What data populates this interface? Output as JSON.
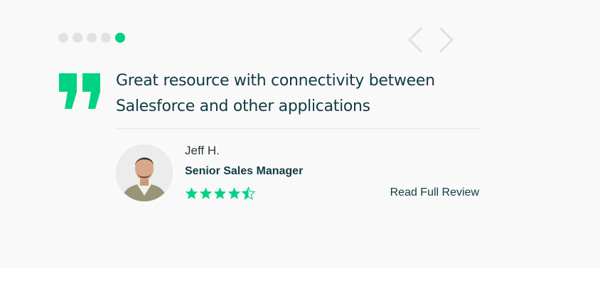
{
  "carousel": {
    "dot_count": 5,
    "active_index": 4,
    "accent_color": "#00d283"
  },
  "navigation": {
    "prev_icon": "chevron-left-icon",
    "next_icon": "chevron-right-icon"
  },
  "testimonial": {
    "quote_icon": "quote-icon",
    "quote": "Great resource with connectivity between Salesforce and other applications",
    "reviewer": {
      "name": "Jeff H.",
      "title": "Senior Sales Manager",
      "avatar_icon": "avatar"
    },
    "rating": {
      "value": 4.5,
      "max": 5
    },
    "read_more_label": "Read Full Review"
  }
}
